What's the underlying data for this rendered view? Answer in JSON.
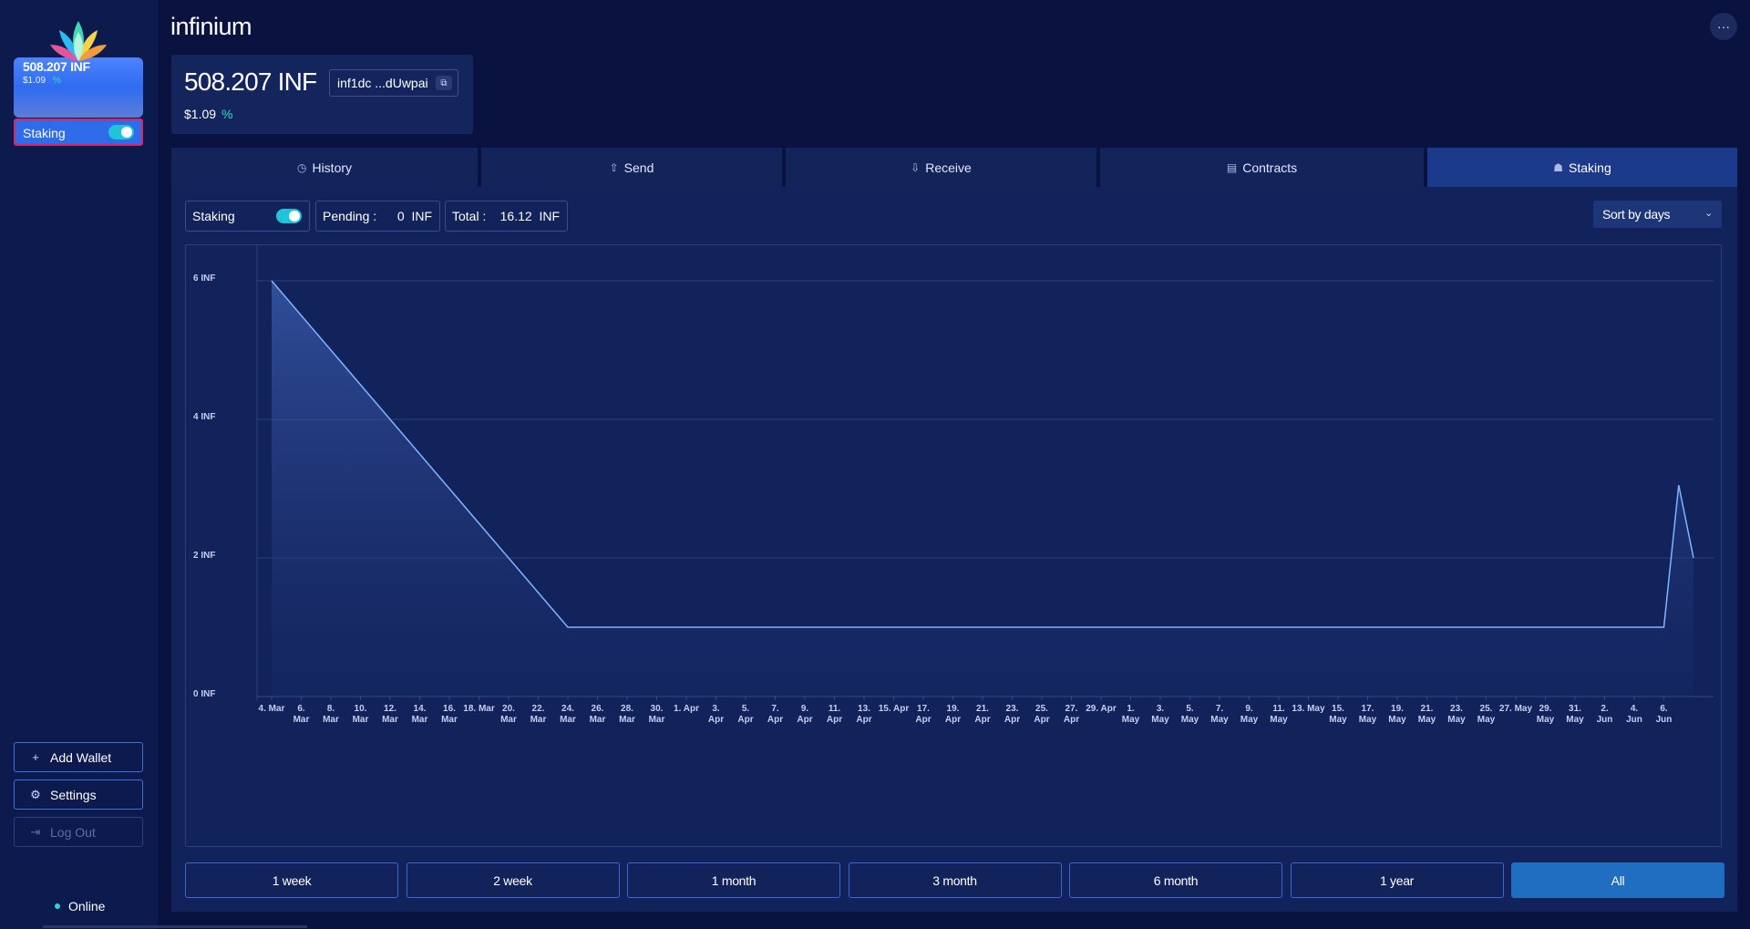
{
  "sidebar": {
    "card": {
      "balance": "508.207  INF",
      "usd": "$1.09",
      "pct": "%"
    },
    "staking_label": "Staking",
    "staking_on": true,
    "add_wallet": "Add Wallet",
    "settings": "Settings",
    "logout": "Log Out",
    "status": "Online"
  },
  "header": {
    "title": "infinium",
    "more": "···",
    "balance": "508.207 INF",
    "address": "inf1dc ...dUwpai",
    "usd": "$1.09",
    "pct": "%"
  },
  "tabs": [
    {
      "label": "History",
      "icon": "clock-icon"
    },
    {
      "label": "Send",
      "icon": "upload-icon"
    },
    {
      "label": "Receive",
      "icon": "download-icon"
    },
    {
      "label": "Contracts",
      "icon": "document-icon"
    },
    {
      "label": "Staking",
      "icon": "stack-icon"
    }
  ],
  "staking_panel": {
    "staking_label": "Staking",
    "pending_label": "Pending :",
    "pending_value": "0  INF",
    "total_label": "Total :",
    "total_value": "16.12  INF",
    "sort": "Sort by days",
    "ranges": [
      "1 week",
      "2 week",
      "1 month",
      "3 month",
      "6 month",
      "1 year",
      "All"
    ],
    "active_range": "All"
  },
  "colors": {
    "accent": "#1f6ec2",
    "teal": "#29e0c8",
    "line": "#7fb4ff"
  },
  "chart_data": {
    "type": "area",
    "y_unit": "INF",
    "ylim": [
      0,
      8
    ],
    "yticks": [
      "0 INF",
      "2 INF",
      "4 INF",
      "6 INF"
    ],
    "top_tick": "...",
    "grid": true,
    "x_ticks": [
      "4. Mar",
      "6. Mar",
      "8. Mar",
      "10. Mar",
      "12. Mar",
      "14. Mar",
      "16. Mar",
      "18. Mar",
      "20. Mar",
      "22. Mar",
      "24. Mar",
      "26. Mar",
      "28. Mar",
      "30. Mar",
      "1. Apr",
      "3. Apr",
      "5. Apr",
      "7. Apr",
      "9. Apr",
      "11. Apr",
      "13. Apr",
      "15. Apr",
      "17. Apr",
      "19. Apr",
      "21. Apr",
      "23. Apr",
      "25. Apr",
      "27. Apr",
      "29. Apr",
      "1. May",
      "3. May",
      "5. May",
      "7. May",
      "9. May",
      "11. May",
      "13. May",
      "15. May",
      "17. May",
      "19. May",
      "21. May",
      "23. May",
      "25. May",
      "27. May",
      "29. May",
      "31. May",
      "2. Jun",
      "4. Jun",
      "6. Jun"
    ],
    "points": [
      {
        "x": "4. Mar",
        "y": 6.0
      },
      {
        "x": "24. Mar",
        "y": 1.0
      },
      {
        "x": "6. Jun",
        "y": 1.0
      },
      {
        "x": "7. Jun",
        "y": 3.05
      },
      {
        "x": "8. Jun",
        "y": 2.0
      }
    ]
  }
}
